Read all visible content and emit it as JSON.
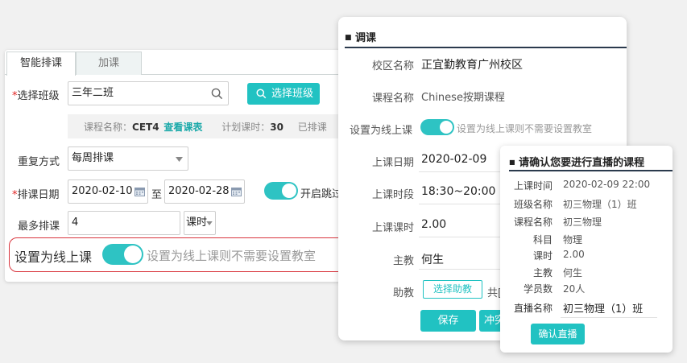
{
  "schedule_panel": {
    "tabs": [
      "智能排课",
      "加课"
    ],
    "select_class_label": "选择班级",
    "class_value": "三年二班",
    "select_class_button": "选择班级",
    "course_name_label": "课程名称：",
    "course_name": "CET4",
    "view_schedule_link": "查看课表",
    "planned_hours_label": "计划课时：",
    "planned_hours": "30",
    "scheduled_label": "已排课",
    "repeat_label": "重复方式",
    "repeat_value": "每周排课",
    "date_label": "排课日期",
    "date_start": "2020-02-10",
    "date_to": "至",
    "date_end": "2020-02-28",
    "skip_label": "开启跳过",
    "max_label": "最多排课",
    "max_value": "4",
    "max_unit": "课时",
    "online_label": "设置为线上课",
    "online_hint": "设置为线上课则不需要设置教室"
  },
  "adjust_panel": {
    "title": "调课",
    "campus_label": "校区名称",
    "campus_value": "正宜勤教育广州校区",
    "course_label": "课程名称",
    "course_value": "Chinese按期课程",
    "online_label": "设置为线上课",
    "online_hint": "设置为线上课则不需要设置教室",
    "date_label": "上课日期",
    "date_value": "2020-02-09",
    "time_label": "上课时段",
    "time_value": "18:30~20:00",
    "hours_label": "上课课时",
    "hours_value": "2.00",
    "teacher_label": "主教",
    "teacher_value": "何生",
    "assistant_label": "助教",
    "assistant_button": "选择助教",
    "assistant_extra": "共[",
    "save_button": "保存",
    "conflict_button": "冲突"
  },
  "confirm_panel": {
    "title": "请确认您要进行直播的课程",
    "rows": [
      {
        "label": "上课时间",
        "value": "2020-02-09 22:00"
      },
      {
        "label": "班级名称",
        "value": "初三物理（1）班"
      },
      {
        "label": "课程名称",
        "value": "初三物理"
      },
      {
        "label": "科目",
        "value": "物理"
      },
      {
        "label": "课时",
        "value": "2.00"
      },
      {
        "label": "主教",
        "value": "何生"
      },
      {
        "label": "学员数",
        "value": "20人"
      }
    ],
    "live_name_label": "直播名称",
    "live_name_value": "初三物理（1）班",
    "confirm_button": "确认直播"
  },
  "colors": {
    "accent": "#21c2c2",
    "link": "#1aa9a9",
    "required": "#e02020",
    "highlight_border": "#d9363e"
  }
}
